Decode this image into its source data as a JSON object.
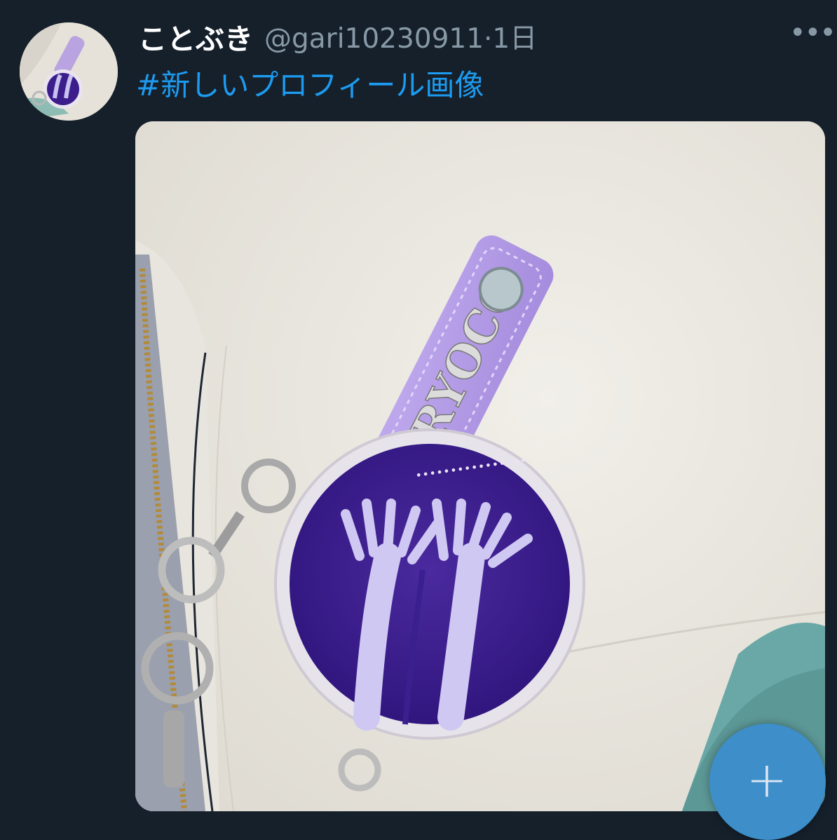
{
  "tweet": {
    "display_name": "ことぶき",
    "handle_time": "@gari10230911·1日",
    "hashtag": "#新しいプロフィール画像",
    "more_icon": "more-horizontal-icon"
  },
  "fab": {
    "icon": "plus-icon",
    "label": "+",
    "color": "#3d8ec9"
  },
  "colors": {
    "background": "#15202b",
    "link": "#1d9bf0",
    "secondary_text": "#8899a6"
  }
}
